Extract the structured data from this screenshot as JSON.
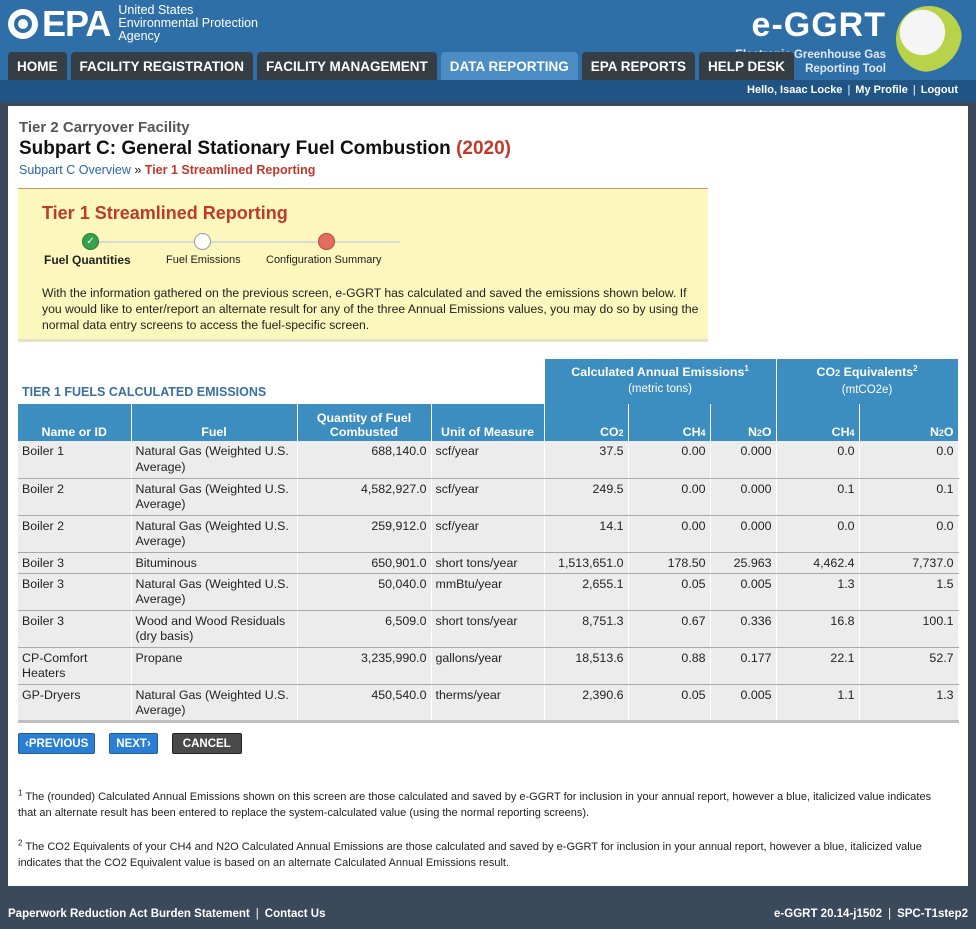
{
  "header": {
    "agency_abbr": "EPA",
    "agency_lines": [
      "United States",
      "Environmental Protection",
      "Agency"
    ],
    "app_name": "e-GGRT",
    "app_subtitle_lines": [
      "Electronic Greenhouse Gas",
      "Reporting Tool"
    ]
  },
  "nav": {
    "tabs": [
      "HOME",
      "FACILITY REGISTRATION",
      "FACILITY MANAGEMENT",
      "DATA REPORTING",
      "EPA REPORTS",
      "HELP DESK"
    ],
    "active_tab": "DATA REPORTING"
  },
  "userbar": {
    "greeting": "Hello, Isaac Locke",
    "profile": "My Profile",
    "logout": "Logout"
  },
  "page": {
    "facility": "Tier 2 Carryover Facility",
    "subpart_title": "Subpart C: General Stationary Fuel Combustion",
    "year": "(2020)",
    "breadcrumb_link": "Subpart C Overview",
    "breadcrumb_sep": "»",
    "breadcrumb_current": "Tier 1 Streamlined Reporting"
  },
  "infobox": {
    "title": "Tier 1 Streamlined Reporting",
    "steps": [
      "Fuel Quantities",
      "Fuel Emissions",
      "Configuration Summary"
    ],
    "text": "With the information gathered on the previous screen, e-GGRT has calculated and saved the emissions shown below. If you would like to enter/report an alternate result for any of the three Annual Emissions values, you may do so by using the normal data entry screens to access the fuel-specific screen."
  },
  "table": {
    "caption": "TIER 1 FUELS CALCULATED EMISSIONS",
    "group1_title": "Calculated Annual Emissions",
    "group1_sup": "1",
    "group1_sub": "(metric tons)",
    "group2_title_pre": "CO",
    "group2_title_sub": "2",
    "group2_title_post": " Equivalents",
    "group2_sup": "2",
    "group2_sub": "(mtCO2e)",
    "columns": [
      "Name or ID",
      "Fuel",
      "Quantity of Fuel Combusted",
      "Unit of Measure",
      "CO2",
      "CH4",
      "N2O",
      "CH4",
      "N2O"
    ],
    "rows": [
      {
        "name": "Boiler 1",
        "fuel": "Natural Gas (Weighted U.S. Average)",
        "qty": "688,140.0",
        "unit": "scf/year",
        "co2": "37.5",
        "ch4": "0.00",
        "n2o": "0.000",
        "ch4e": "0.0",
        "n2oe": "0.0"
      },
      {
        "name": "Boiler 2",
        "fuel": "Natural Gas (Weighted U.S. Average)",
        "qty": "4,582,927.0",
        "unit": "scf/year",
        "co2": "249.5",
        "ch4": "0.00",
        "n2o": "0.000",
        "ch4e": "0.1",
        "n2oe": "0.1"
      },
      {
        "name": "Boiler 2",
        "fuel": "Natural Gas (Weighted U.S. Average)",
        "qty": "259,912.0",
        "unit": "scf/year",
        "co2": "14.1",
        "ch4": "0.00",
        "n2o": "0.000",
        "ch4e": "0.0",
        "n2oe": "0.0"
      },
      {
        "name": "Boiler 3",
        "fuel": "Bituminous",
        "qty": "650,901.0",
        "unit": "short tons/year",
        "co2": "1,513,651.0",
        "ch4": "178.50",
        "n2o": "25.963",
        "ch4e": "4,462.4",
        "n2oe": "7,737.0"
      },
      {
        "name": "Boiler 3",
        "fuel": "Natural Gas (Weighted U.S. Average)",
        "qty": "50,040.0",
        "unit": "mmBtu/year",
        "co2": "2,655.1",
        "ch4": "0.05",
        "n2o": "0.005",
        "ch4e": "1.3",
        "n2oe": "1.5"
      },
      {
        "name": "Boiler 3",
        "fuel": "Wood and Wood Residuals (dry basis)",
        "qty": "6,509.0",
        "unit": "short tons/year",
        "co2": "8,751.3",
        "ch4": "0.67",
        "n2o": "0.336",
        "ch4e": "16.8",
        "n2oe": "100.1"
      },
      {
        "name": "CP-Comfort Heaters",
        "fuel": "Propane",
        "qty": "3,235,990.0",
        "unit": "gallons/year",
        "co2": "18,513.6",
        "ch4": "0.88",
        "n2o": "0.177",
        "ch4e": "22.1",
        "n2oe": "52.7"
      },
      {
        "name": "GP-Dryers",
        "fuel": "Natural Gas (Weighted U.S. Average)",
        "qty": "450,540.0",
        "unit": "therms/year",
        "co2": "2,390.6",
        "ch4": "0.05",
        "n2o": "0.005",
        "ch4e": "1.1",
        "n2oe": "1.3"
      }
    ]
  },
  "buttons": {
    "previous": "PREVIOUS",
    "next": "NEXT",
    "cancel": "CANCEL"
  },
  "footnotes": {
    "f1_num": "1",
    "f1": "The (rounded) Calculated Annual Emissions shown on this screen are those calculated and saved by e-GGRT for inclusion in your annual report, however a blue, italicized value indicates that an alternate result has been entered to replace the system-calculated value (using the normal reporting screens).",
    "f2_num": "2",
    "f2": "The CO2 Equivalents of your CH4 and N2O Calculated Annual Emissions are those calculated and saved by e-GGRT for inclusion in your annual report, however a blue, italicized value indicates that the CO2 Equivalent value is based on an alternate Calculated Annual Emissions result."
  },
  "footer": {
    "paperwork": "Paperwork Reduction Act Burden Statement",
    "contact": "Contact Us",
    "version": "e-GGRT 20.14-j1502",
    "screen_id": "SPC-T1step2"
  },
  "colors": {
    "header_blue": "#2f6fa8",
    "table_header": "#3c8dc0",
    "accent_red": "#c0392b",
    "info_yellow": "#fbf7bd"
  }
}
